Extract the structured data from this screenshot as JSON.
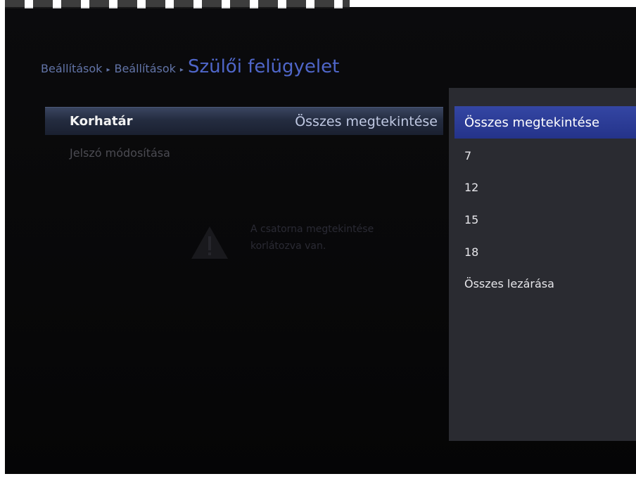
{
  "breadcrumb": {
    "crumb1": "Beállítások",
    "crumb2": "Beállítások",
    "current": "Szülői felügyelet",
    "separator": "▸"
  },
  "menu": {
    "items": [
      {
        "label": "Korhatár",
        "value": "Összes megtekintése"
      },
      {
        "label": "Jelszó módosítása"
      }
    ]
  },
  "warning": {
    "icon": "warning-icon",
    "line1": "A csatorna megtekintése",
    "line2": "korlátozva van."
  },
  "dropdown": {
    "options": [
      "Összes megtekintése",
      "7",
      "12",
      "15",
      "18",
      "Összes lezárása"
    ],
    "selected": "Összes megtekintése"
  },
  "colors": {
    "selection_blue": "#2a3a94",
    "breadcrumb_blue": "#4f66c9",
    "panel": "#2a2b31"
  }
}
